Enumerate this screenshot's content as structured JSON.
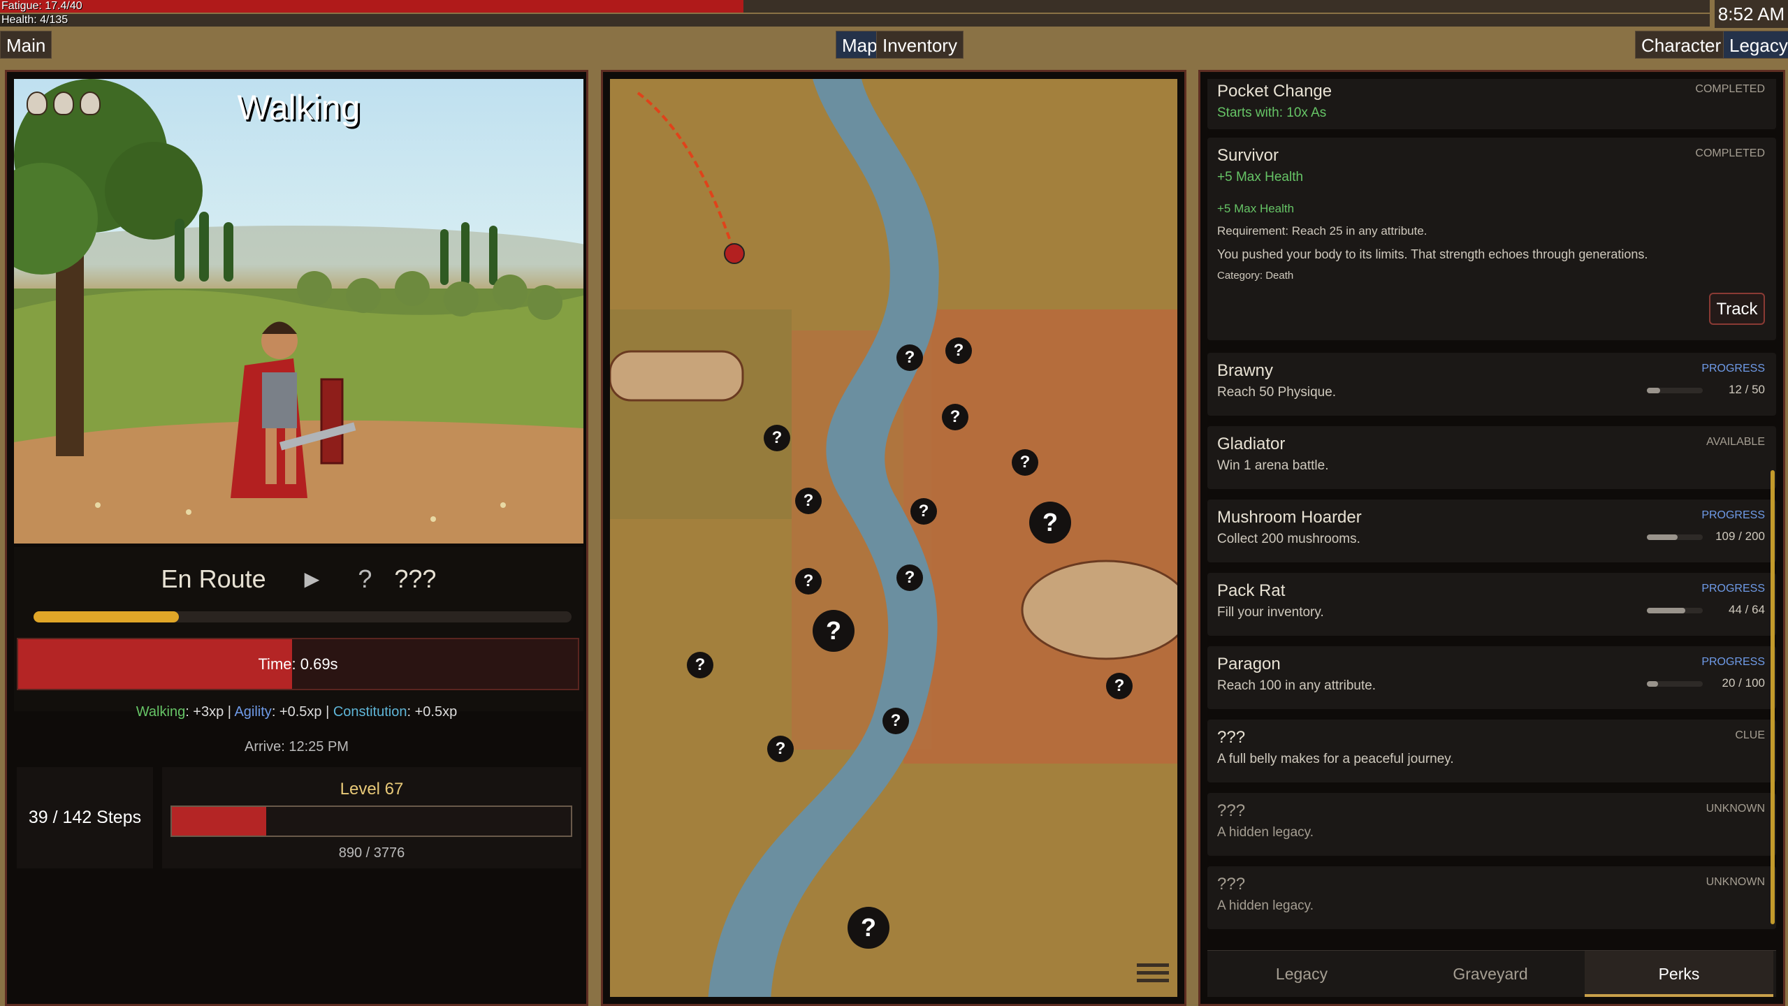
{
  "status": {
    "fatigue_label": "Fatigue: 17.4/40",
    "fatigue_fraction": 0.435,
    "health_label": "Health: 4/135",
    "health_fraction": 0.03,
    "clock": "8:52 AM"
  },
  "nav": {
    "main": "Main",
    "map": "Map",
    "inventory": "Inventory",
    "character": "Character",
    "legacy": "Legacy"
  },
  "scene": {
    "title": "Walking",
    "skull_icons": [
      "skull-icon",
      "skull-icon",
      "skull-icon"
    ]
  },
  "route": {
    "status": "En Route",
    "destination_icon": "?",
    "destination": "???",
    "progress_fraction": 0.27
  },
  "timer": {
    "label": "Time: 0.69s",
    "fraction": 0.49
  },
  "xp": {
    "walking_name": "Walking",
    "walking_value": ": +3xp",
    "agility_name": "Agility",
    "agility_value": ": +0.5xp",
    "constitution_name": "Constitution",
    "constitution_value": ": +0.5xp",
    "separator": " | "
  },
  "arrive": "Arrive: 12:25 PM",
  "steps": "39 / 142 Steps",
  "level": {
    "label": "Level 67",
    "xp": "890 / 3776",
    "fraction": 0.236
  },
  "map": {
    "pin_symbol": "?",
    "menu_icon": "hamburger-menu-icon"
  },
  "legacies": [
    {
      "name": "Pocket Change",
      "sub": "Starts with: 10x As",
      "status": "COMPLETED",
      "sub_is_reward": true
    },
    {
      "name": "Survivor",
      "sub": "+5 Max Health",
      "status": "COMPLETED",
      "sub_is_reward": true,
      "detail_reward": "+5 Max Health",
      "detail_requirement": "Requirement: Reach 25 in any attribute.",
      "detail_description": "You pushed your body to its limits. That strength echoes through generations.",
      "detail_category": "Category: Death",
      "track_label": "Track"
    },
    {
      "name": "Brawny",
      "sub": "Reach 50 Physique.",
      "status": "PROGRESS",
      "count": "12 / 50",
      "progress": 0.24
    },
    {
      "name": "Gladiator",
      "sub": "Win 1 arena battle.",
      "status": "AVAILABLE"
    },
    {
      "name": "Mushroom Hoarder",
      "sub": "Collect 200 mushrooms.",
      "status": "PROGRESS",
      "count": "109 / 200",
      "progress": 0.545
    },
    {
      "name": "Pack Rat",
      "sub": "Fill your inventory.",
      "status": "PROGRESS",
      "count": "44 / 64",
      "progress": 0.69
    },
    {
      "name": "Paragon",
      "sub": "Reach 100 in any attribute.",
      "status": "PROGRESS",
      "count": "20 / 100",
      "progress": 0.2
    },
    {
      "name": "???",
      "sub": "A full belly makes for a peaceful journey.",
      "status": "CLUE"
    },
    {
      "name": "???",
      "sub": "A hidden legacy.",
      "status": "UNKNOWN"
    },
    {
      "name": "???",
      "sub": "A hidden legacy.",
      "status": "UNKNOWN"
    }
  ],
  "tabs": {
    "legacy": "Legacy",
    "graveyard": "Graveyard",
    "perks": "Perks",
    "active": "Perks"
  },
  "colors": {
    "health_red": "#b01a1a",
    "progress_gold": "#e0a628",
    "reward_green": "#66c466",
    "progress_blue": "#6f9be8",
    "panel_border": "#5e2d22"
  }
}
